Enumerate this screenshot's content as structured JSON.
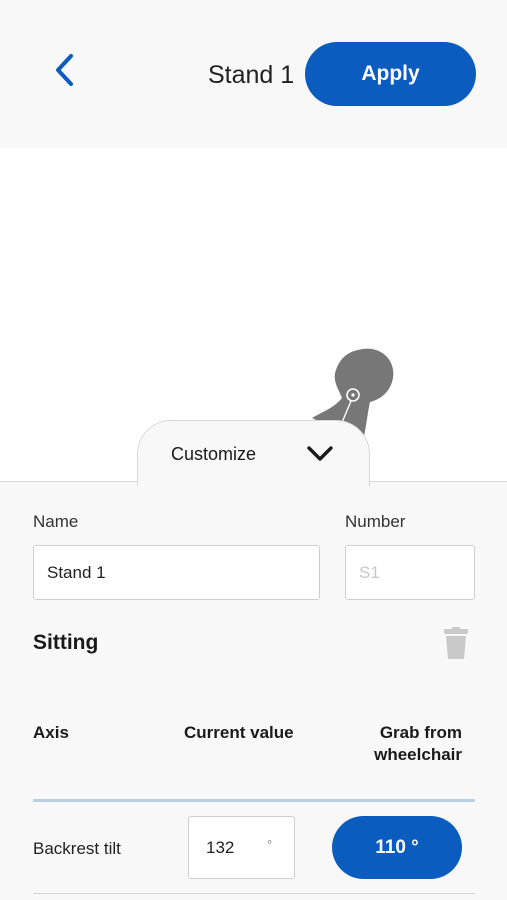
{
  "header": {
    "title": "Stand 1",
    "apply_label": "Apply"
  },
  "customize": {
    "label": "Customize"
  },
  "form": {
    "name_label": "Name",
    "name_value": "Stand 1",
    "number_label": "Number",
    "number_placeholder": "S1"
  },
  "section": {
    "title": "Sitting"
  },
  "table": {
    "col_axis": "Axis",
    "col_current": "Current value",
    "col_grab_line1": "Grab from",
    "col_grab_line2": "wheelchair",
    "rows": [
      {
        "axis": "Backrest tilt",
        "current_value": "132",
        "unit": "°",
        "grab_value": "110 °"
      }
    ]
  },
  "colors": {
    "accent": "#0a5cbf",
    "panel_bg": "#f8f8f8",
    "figure": "#777777"
  },
  "icons": {
    "back": "chevron-left-icon",
    "customize_toggle": "chevron-down-icon",
    "delete": "trash-icon"
  }
}
